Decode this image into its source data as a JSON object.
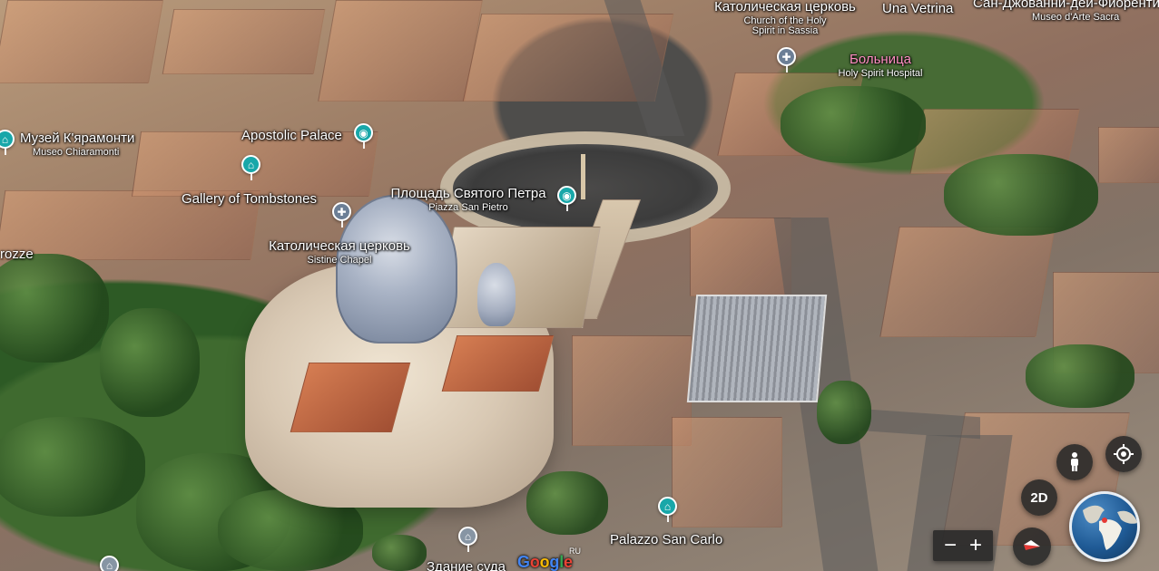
{
  "map": {
    "labels": {
      "museo_chiaramonti": {
        "primary": "Музей К'ярамонти",
        "secondary": "Museo Chiaramonti"
      },
      "apostolic_palace": {
        "primary": "Apostolic Palace",
        "secondary": ""
      },
      "gallery_of_tombstones": {
        "primary": "Gallery of Tombstones",
        "secondary": ""
      },
      "piazza_san_pietro": {
        "primary": "Площадь Святого Петра",
        "secondary": "Piazza San Pietro"
      },
      "sistine_chapel": {
        "primary": "Католическая церковь",
        "secondary": "Sistine Chapel"
      },
      "holy_spirit_church": {
        "primary": "Католическая церковь",
        "secondary": "Church of the Holy\nSpirit in Sassia"
      },
      "hospital": {
        "primary": "Больница",
        "secondary": "Holy Spirit Hospital"
      },
      "una_vetrina": {
        "primary": "Una Vetrina",
        "secondary": ""
      },
      "museo_arte_sacra": {
        "primary": "Сан-Джованни-деи-Фиорентини",
        "secondary": "Museo d'Arte Sacra"
      },
      "palazzo_san_carlo": {
        "primary": "Palazzo San Carlo",
        "secondary": ""
      },
      "zdanie_suda": {
        "primary": "Здание суда",
        "secondary": ""
      },
      "rozze_partial": {
        "primary": "rozze",
        "secondary": ""
      }
    },
    "controls": {
      "view_2d_label": "2D",
      "zoom_out_label": "−",
      "zoom_in_label": "+"
    },
    "branding": {
      "logo": "Google",
      "language": "RU"
    },
    "icons": {
      "poi_museum": "museum-icon",
      "poi_camera": "camera-icon",
      "poi_church": "church-icon",
      "poi_hospital": "hospital-icon",
      "pegman": "pegman-icon",
      "location": "location-icon",
      "compass": "compass-icon",
      "globe": "globe-icon"
    },
    "colors": {
      "poi_teal": "#18a7a9",
      "poi_blue": "#6c7f96",
      "hospital_label": "#ff8fc2"
    }
  }
}
